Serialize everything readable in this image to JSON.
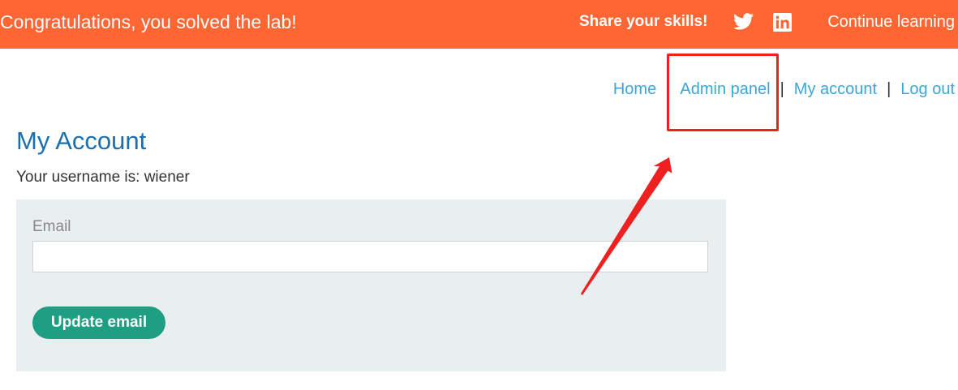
{
  "banner": {
    "message": "Congratulations, you solved the lab!",
    "share_label": "Share your skills!",
    "twitter_icon": "twitter-icon",
    "linkedin_icon": "linkedin-icon",
    "continue_label": "Continue learning",
    "color": "#ff6633"
  },
  "nav": {
    "home": "Home",
    "admin_panel": "Admin panel",
    "my_account": "My account",
    "log_out": "Log out",
    "separator": "|",
    "link_color": "#3ba6d8"
  },
  "page": {
    "title": "My Account",
    "username_line": "Your username is: wiener"
  },
  "form": {
    "email_label": "Email",
    "email_value": "",
    "update_button": "Update email",
    "button_color": "#1e9e82",
    "panel_color": "#e9eef0"
  },
  "annotation": {
    "color": "#ee2020"
  }
}
